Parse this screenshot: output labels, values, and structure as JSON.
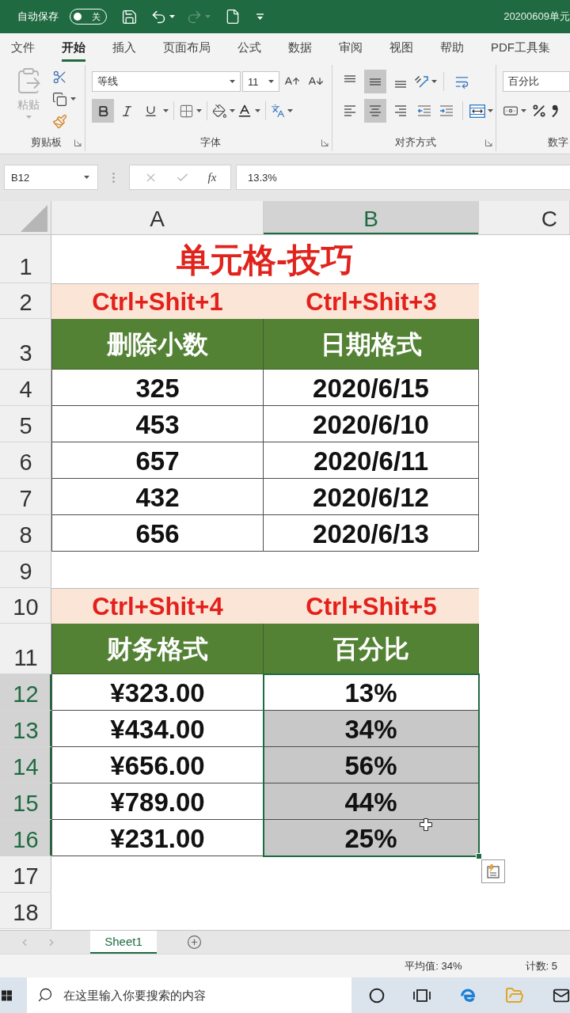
{
  "title_bar": {
    "autosave_label": "自动保存",
    "autosave_toggle": {
      "label": "关",
      "on": false
    },
    "redo_disabled": true,
    "document_title": "20200609单元"
  },
  "ribbon_tabs": [
    {
      "label": "文件",
      "selected": false
    },
    {
      "label": "开始",
      "selected": true
    },
    {
      "label": "插入",
      "selected": false
    },
    {
      "label": "页面布局",
      "selected": false
    },
    {
      "label": "公式",
      "selected": false
    },
    {
      "label": "数据",
      "selected": false
    },
    {
      "label": "审阅",
      "selected": false
    },
    {
      "label": "视图",
      "selected": false
    },
    {
      "label": "帮助",
      "selected": false
    },
    {
      "label": "PDF工具集",
      "selected": false
    }
  ],
  "ribbon": {
    "clipboard": {
      "group_label": "剪贴板",
      "paste_label": "粘贴",
      "paste_disabled": true
    },
    "font": {
      "group_label": "字体",
      "font_name": "等线",
      "font_size": "11",
      "styles": [
        {
          "kind": "bold",
          "on": true
        },
        {
          "kind": "italic",
          "on": false
        },
        {
          "kind": "underline",
          "on": false
        }
      ]
    },
    "alignment": {
      "group_label": "对齐方式",
      "vertical": [
        {
          "kind": "top",
          "on": false
        },
        {
          "kind": "middle",
          "on": true
        },
        {
          "kind": "bottom",
          "on": false
        }
      ],
      "horizontal": [
        {
          "kind": "left",
          "on": false
        },
        {
          "kind": "center",
          "on": true
        },
        {
          "kind": "right",
          "on": false
        }
      ]
    },
    "number": {
      "group_label": "数字",
      "format": "百分比"
    }
  },
  "formula_bar": {
    "name_box": "B12",
    "function_label": "fx",
    "formula": "13.3%"
  },
  "columns": [
    {
      "label": "A",
      "selected": false
    },
    {
      "label": "B",
      "selected": true
    },
    {
      "label": "C",
      "selected": false
    }
  ],
  "rows": [
    {
      "number": "1",
      "kind": "title",
      "selected": false,
      "cells": [
        "单元格-技巧"
      ]
    },
    {
      "number": "2",
      "kind": "shortcut",
      "selected": false,
      "cells": [
        "Ctrl+Shit+1",
        "Ctrl+Shit+3"
      ]
    },
    {
      "number": "3",
      "kind": "header",
      "selected": false,
      "cells": [
        "删除小数",
        "日期格式"
      ]
    },
    {
      "number": "4",
      "kind": "data",
      "selected": false,
      "cells": [
        "325",
        "2020/6/15"
      ]
    },
    {
      "number": "5",
      "kind": "data",
      "selected": false,
      "cells": [
        "453",
        "2020/6/10"
      ]
    },
    {
      "number": "6",
      "kind": "data",
      "selected": false,
      "cells": [
        "657",
        "2020/6/11"
      ]
    },
    {
      "number": "7",
      "kind": "data",
      "selected": false,
      "cells": [
        "432",
        "2020/6/12"
      ]
    },
    {
      "number": "8",
      "kind": "data",
      "selected": false,
      "cells": [
        "656",
        "2020/6/13"
      ]
    },
    {
      "number": "9",
      "kind": "empty",
      "selected": false
    },
    {
      "number": "10",
      "kind": "shortcut",
      "selected": false,
      "cells": [
        "Ctrl+Shit+4",
        "Ctrl+Shit+5"
      ]
    },
    {
      "number": "11",
      "kind": "header",
      "selected": false,
      "cells": [
        "财务格式",
        "百分比"
      ]
    },
    {
      "number": "12",
      "kind": "data",
      "selected": true,
      "active": true,
      "cells": [
        "¥323.00",
        "13%"
      ]
    },
    {
      "number": "13",
      "kind": "data",
      "selected": true,
      "active": false,
      "cells": [
        "¥434.00",
        "34%"
      ]
    },
    {
      "number": "14",
      "kind": "data",
      "selected": true,
      "active": false,
      "cells": [
        "¥656.00",
        "56%"
      ]
    },
    {
      "number": "15",
      "kind": "data",
      "selected": true,
      "active": false,
      "cells": [
        "¥789.00",
        "44%"
      ]
    },
    {
      "number": "16",
      "kind": "data",
      "selected": true,
      "active": false,
      "cells": [
        "¥231.00",
        "25%"
      ]
    },
    {
      "number": "17",
      "kind": "empty",
      "selected": false
    },
    {
      "number": "18",
      "kind": "empty",
      "selected": false
    }
  ],
  "sheet_tabs": [
    {
      "label": "Sheet1",
      "selected": true
    }
  ],
  "status_bar": {
    "average": "平均值: 34%",
    "count": "计数: 5"
  },
  "taskbar": {
    "search": {
      "placeholder": "在这里输入你要搜索的内容"
    }
  }
}
